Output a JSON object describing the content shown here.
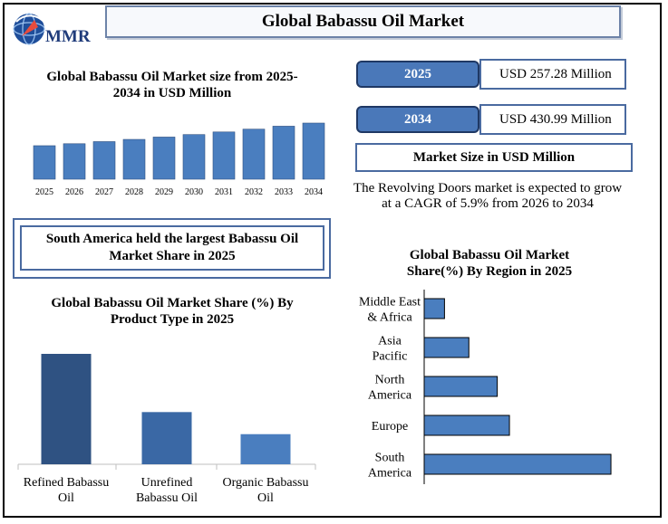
{
  "header": {
    "title": "Global Babassu Oil Market",
    "logo_text": "MMR"
  },
  "market_size": {
    "entries": [
      {
        "year": "2025",
        "value": "USD 257.28 Million"
      },
      {
        "year": "2034",
        "value": "USD 430.99 Million"
      }
    ],
    "caption": "Market Size in USD Million",
    "cagr_text": "The Revolving Doors market is expected to grow at a CAGR of 5.9% from 2026 to 2034"
  },
  "highlight": {
    "text": "South America held the largest Babassu Oil Market Share in 2025"
  },
  "colors": {
    "bar_light": "#4a7ebf",
    "bar_dark": "#2f5282",
    "bar_mid": "#3a68a5",
    "border": "#4a6aa0"
  },
  "chart_data": [
    {
      "type": "bar",
      "title": "Global Babassu Oil Market size from 2025-2034 in USD Million",
      "categories": [
        "2025",
        "2026",
        "2027",
        "2028",
        "2029",
        "2030",
        "2031",
        "2032",
        "2033",
        "2034"
      ],
      "values": [
        257.28,
        272.5,
        288.6,
        305.6,
        323.6,
        342.7,
        362.9,
        384.3,
        407.0,
        430.99
      ],
      "ylim": [
        0,
        430.99
      ],
      "grid": false
    },
    {
      "type": "bar",
      "title": "Global Babassu Oil Market Share (%) By Product  Type in 2025",
      "categories": [
        "Refined Babassu Oil",
        "Unrefined Babassu Oil",
        "Organic Babassu Oil"
      ],
      "values": [
        55,
        26,
        15
      ],
      "ylim": [
        0,
        60
      ],
      "grid": false
    },
    {
      "type": "bar",
      "orientation": "horizontal",
      "title": "Global Babassu Oil Market Share(%)  By Region in 2025",
      "categories": [
        "Middle East & Africa",
        "Asia Pacific",
        "North America",
        "Europe",
        "South America"
      ],
      "values": [
        5,
        11,
        18,
        21,
        46
      ],
      "xlim": [
        0,
        48
      ],
      "grid": false
    }
  ]
}
